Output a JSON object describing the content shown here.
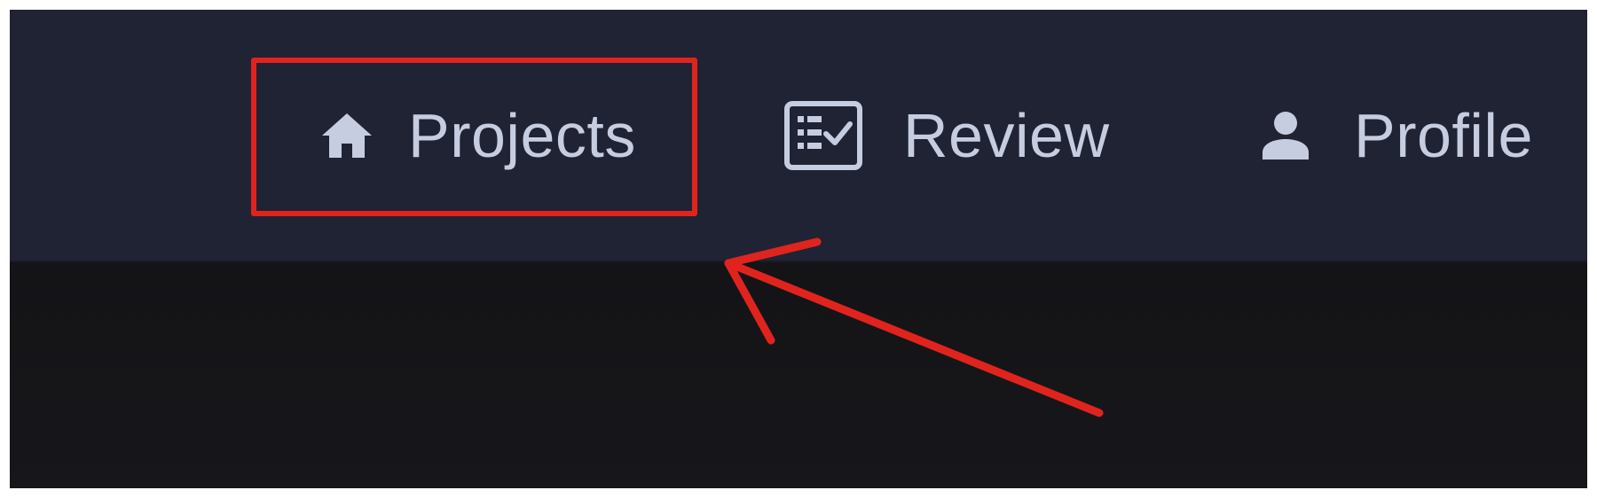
{
  "navbar": {
    "items": [
      {
        "label": "Projects",
        "icon": "home-icon"
      },
      {
        "label": "Review",
        "icon": "checklist-icon"
      },
      {
        "label": "Profile",
        "icon": "person-icon"
      }
    ]
  },
  "colors": {
    "navbar_background": "#202334",
    "content_background": "#16161a",
    "nav_text": "#c7cde0",
    "annotation": "#e0241d"
  }
}
